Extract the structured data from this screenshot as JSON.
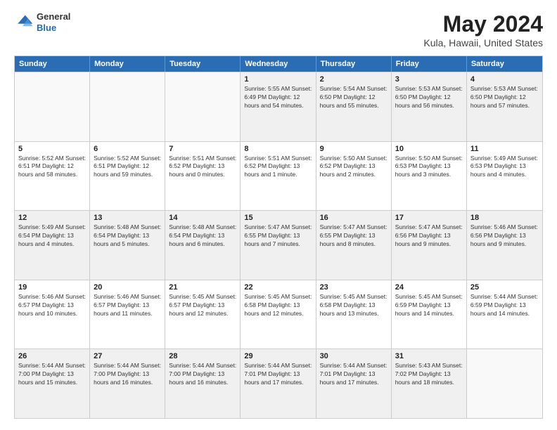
{
  "logo": {
    "general": "General",
    "blue": "Blue"
  },
  "title": "May 2024",
  "subtitle": "Kula, Hawaii, United States",
  "days_of_week": [
    "Sunday",
    "Monday",
    "Tuesday",
    "Wednesday",
    "Thursday",
    "Friday",
    "Saturday"
  ],
  "weeks": [
    [
      {
        "day": "",
        "info": "",
        "empty": true
      },
      {
        "day": "",
        "info": "",
        "empty": true
      },
      {
        "day": "",
        "info": "",
        "empty": true
      },
      {
        "day": "1",
        "info": "Sunrise: 5:55 AM\nSunset: 6:49 PM\nDaylight: 12 hours\nand 54 minutes.",
        "empty": false
      },
      {
        "day": "2",
        "info": "Sunrise: 5:54 AM\nSunset: 6:50 PM\nDaylight: 12 hours\nand 55 minutes.",
        "empty": false
      },
      {
        "day": "3",
        "info": "Sunrise: 5:53 AM\nSunset: 6:50 PM\nDaylight: 12 hours\nand 56 minutes.",
        "empty": false
      },
      {
        "day": "4",
        "info": "Sunrise: 5:53 AM\nSunset: 6:50 PM\nDaylight: 12 hours\nand 57 minutes.",
        "empty": false
      }
    ],
    [
      {
        "day": "5",
        "info": "Sunrise: 5:52 AM\nSunset: 6:51 PM\nDaylight: 12 hours\nand 58 minutes.",
        "empty": false
      },
      {
        "day": "6",
        "info": "Sunrise: 5:52 AM\nSunset: 6:51 PM\nDaylight: 12 hours\nand 59 minutes.",
        "empty": false
      },
      {
        "day": "7",
        "info": "Sunrise: 5:51 AM\nSunset: 6:52 PM\nDaylight: 13 hours\nand 0 minutes.",
        "empty": false
      },
      {
        "day": "8",
        "info": "Sunrise: 5:51 AM\nSunset: 6:52 PM\nDaylight: 13 hours\nand 1 minute.",
        "empty": false
      },
      {
        "day": "9",
        "info": "Sunrise: 5:50 AM\nSunset: 6:52 PM\nDaylight: 13 hours\nand 2 minutes.",
        "empty": false
      },
      {
        "day": "10",
        "info": "Sunrise: 5:50 AM\nSunset: 6:53 PM\nDaylight: 13 hours\nand 3 minutes.",
        "empty": false
      },
      {
        "day": "11",
        "info": "Sunrise: 5:49 AM\nSunset: 6:53 PM\nDaylight: 13 hours\nand 4 minutes.",
        "empty": false
      }
    ],
    [
      {
        "day": "12",
        "info": "Sunrise: 5:49 AM\nSunset: 6:54 PM\nDaylight: 13 hours\nand 4 minutes.",
        "empty": false
      },
      {
        "day": "13",
        "info": "Sunrise: 5:48 AM\nSunset: 6:54 PM\nDaylight: 13 hours\nand 5 minutes.",
        "empty": false
      },
      {
        "day": "14",
        "info": "Sunrise: 5:48 AM\nSunset: 6:54 PM\nDaylight: 13 hours\nand 6 minutes.",
        "empty": false
      },
      {
        "day": "15",
        "info": "Sunrise: 5:47 AM\nSunset: 6:55 PM\nDaylight: 13 hours\nand 7 minutes.",
        "empty": false
      },
      {
        "day": "16",
        "info": "Sunrise: 5:47 AM\nSunset: 6:55 PM\nDaylight: 13 hours\nand 8 minutes.",
        "empty": false
      },
      {
        "day": "17",
        "info": "Sunrise: 5:47 AM\nSunset: 6:56 PM\nDaylight: 13 hours\nand 9 minutes.",
        "empty": false
      },
      {
        "day": "18",
        "info": "Sunrise: 5:46 AM\nSunset: 6:56 PM\nDaylight: 13 hours\nand 9 minutes.",
        "empty": false
      }
    ],
    [
      {
        "day": "19",
        "info": "Sunrise: 5:46 AM\nSunset: 6:57 PM\nDaylight: 13 hours\nand 10 minutes.",
        "empty": false
      },
      {
        "day": "20",
        "info": "Sunrise: 5:46 AM\nSunset: 6:57 PM\nDaylight: 13 hours\nand 11 minutes.",
        "empty": false
      },
      {
        "day": "21",
        "info": "Sunrise: 5:45 AM\nSunset: 6:57 PM\nDaylight: 13 hours\nand 12 minutes.",
        "empty": false
      },
      {
        "day": "22",
        "info": "Sunrise: 5:45 AM\nSunset: 6:58 PM\nDaylight: 13 hours\nand 12 minutes.",
        "empty": false
      },
      {
        "day": "23",
        "info": "Sunrise: 5:45 AM\nSunset: 6:58 PM\nDaylight: 13 hours\nand 13 minutes.",
        "empty": false
      },
      {
        "day": "24",
        "info": "Sunrise: 5:45 AM\nSunset: 6:59 PM\nDaylight: 13 hours\nand 14 minutes.",
        "empty": false
      },
      {
        "day": "25",
        "info": "Sunrise: 5:44 AM\nSunset: 6:59 PM\nDaylight: 13 hours\nand 14 minutes.",
        "empty": false
      }
    ],
    [
      {
        "day": "26",
        "info": "Sunrise: 5:44 AM\nSunset: 7:00 PM\nDaylight: 13 hours\nand 15 minutes.",
        "empty": false
      },
      {
        "day": "27",
        "info": "Sunrise: 5:44 AM\nSunset: 7:00 PM\nDaylight: 13 hours\nand 16 minutes.",
        "empty": false
      },
      {
        "day": "28",
        "info": "Sunrise: 5:44 AM\nSunset: 7:00 PM\nDaylight: 13 hours\nand 16 minutes.",
        "empty": false
      },
      {
        "day": "29",
        "info": "Sunrise: 5:44 AM\nSunset: 7:01 PM\nDaylight: 13 hours\nand 17 minutes.",
        "empty": false
      },
      {
        "day": "30",
        "info": "Sunrise: 5:44 AM\nSunset: 7:01 PM\nDaylight: 13 hours\nand 17 minutes.",
        "empty": false
      },
      {
        "day": "31",
        "info": "Sunrise: 5:43 AM\nSunset: 7:02 PM\nDaylight: 13 hours\nand 18 minutes.",
        "empty": false
      },
      {
        "day": "",
        "info": "",
        "empty": true
      }
    ]
  ]
}
